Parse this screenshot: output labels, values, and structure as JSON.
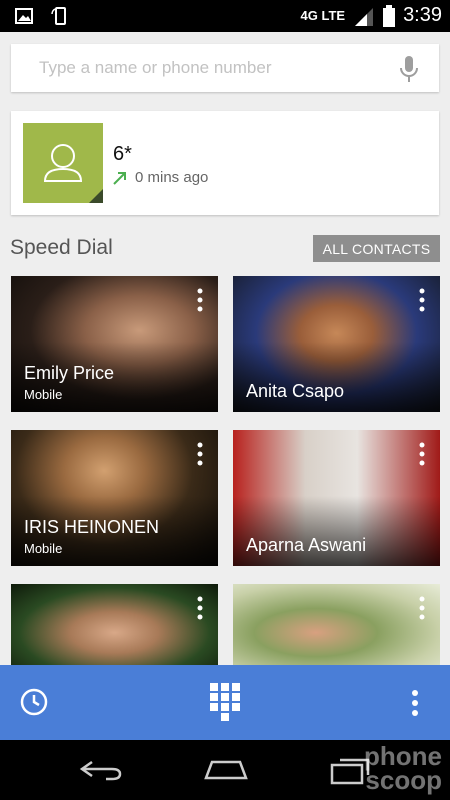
{
  "status_bar": {
    "network": "4G LTE",
    "time": "3:39"
  },
  "search": {
    "placeholder": "Type a name or phone number"
  },
  "recent_call": {
    "number": "6*",
    "time_ago": "0 mins ago"
  },
  "speed_dial": {
    "title": "Speed Dial",
    "all_contacts_label": "ALL CONTACTS",
    "contacts": [
      {
        "name": "Emily Price",
        "label": "Mobile"
      },
      {
        "name": "Anita Csapo",
        "label": ""
      },
      {
        "name": "IRIS HEINONEN",
        "label": "Mobile"
      },
      {
        "name": "Aparna Aswani",
        "label": ""
      },
      {
        "name": "",
        "label": ""
      },
      {
        "name": "",
        "label": ""
      }
    ]
  },
  "watermark": {
    "line1": "phone",
    "line2": "scoop"
  },
  "colors": {
    "action_bar": "#4a7ed7",
    "avatar_bg": "#a0b84a",
    "all_contacts_bg": "#8e8e8e",
    "call_arrow": "#4caf50"
  },
  "icons": [
    "gallery-icon",
    "phone-rotate-icon",
    "signal-icon",
    "battery-icon",
    "mic-icon",
    "outgoing-call-icon",
    "overflow-menu-icon",
    "history-icon",
    "dialpad-icon",
    "back-icon",
    "home-icon",
    "recents-icon"
  ]
}
